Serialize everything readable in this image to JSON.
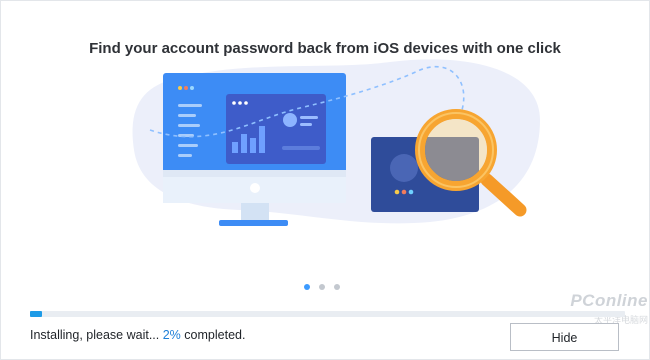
{
  "window": {
    "title": "Find your account password back from iOS devices with one click"
  },
  "carousel": {
    "total": 3,
    "active_index": 0
  },
  "progress": {
    "fraction": 0.02
  },
  "status": {
    "prefix": "Installing, please wait...",
    "percent": "2%",
    "suffix": "completed."
  },
  "buttons": {
    "hide_label": "Hide"
  },
  "watermark": {
    "text": "PConline",
    "sub": "太平洋电脑网"
  },
  "colors": {
    "accent": "#1e9be7",
    "monitor_blue": "#3d8cf5",
    "card_navy": "#2f4c9a",
    "magnifier_orange": "#f7a531"
  },
  "icons": [
    "monitor-icon",
    "magnifier-icon",
    "card-icon"
  ]
}
